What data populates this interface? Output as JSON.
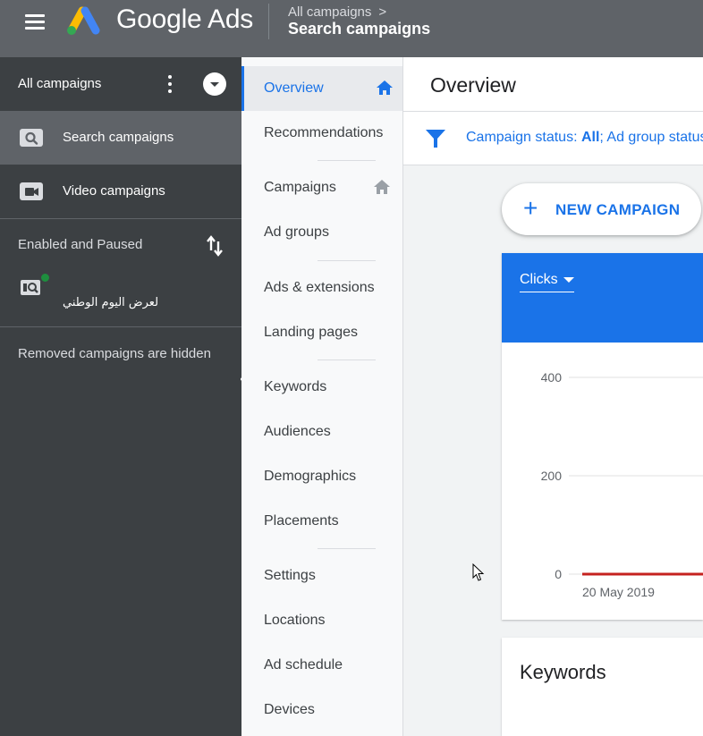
{
  "app": {
    "brand": "Google Ads"
  },
  "breadcrumb": {
    "parent": "All campaigns",
    "current": "Search campaigns"
  },
  "left_panel": {
    "title": "All campaigns",
    "items": [
      {
        "label": "Search campaigns",
        "icon": "search-campaign-icon",
        "active": true
      },
      {
        "label": "Video campaigns",
        "icon": "video-campaign-icon",
        "active": false
      }
    ],
    "section_label": "Enabled and Paused",
    "campaign": {
      "name": "لعرض اليوم الوطني",
      "status": "enabled"
    },
    "removed_note": "Removed campaigns are hidden"
  },
  "page_nav": {
    "items": [
      {
        "label": "Overview",
        "active": true,
        "home": true
      },
      {
        "label": "Recommendations"
      },
      {
        "label": "Campaigns",
        "home": true
      },
      {
        "label": "Ad groups"
      },
      {
        "label": "Ads & extensions"
      },
      {
        "label": "Landing pages"
      },
      {
        "label": "Keywords"
      },
      {
        "label": "Audiences"
      },
      {
        "label": "Demographics"
      },
      {
        "label": "Placements"
      },
      {
        "label": "Settings"
      },
      {
        "label": "Locations"
      },
      {
        "label": "Ad schedule"
      },
      {
        "label": "Devices"
      }
    ]
  },
  "main": {
    "title": "Overview",
    "filter": {
      "prefix": "Campaign status: ",
      "value": "All",
      "rest": "; Ad group status"
    },
    "new_campaign_label": "NEW CAMPAIGN",
    "keywords_title": "Keywords"
  },
  "chart_data": {
    "type": "line",
    "metric": "Clicks",
    "y_ticks": [
      "400",
      "200",
      "0"
    ],
    "ylim": [
      0,
      400
    ],
    "x_tick_labels": [
      "20 May 2019"
    ],
    "series": [
      {
        "values": [
          0,
          0
        ]
      }
    ],
    "grid": true
  },
  "colors": {
    "accent": "#1a73e8",
    "topbar": "#5f6368",
    "left_panel": "#3c4043",
    "series_line": "#c5221f",
    "enabled_dot": "#1e8e3e"
  }
}
